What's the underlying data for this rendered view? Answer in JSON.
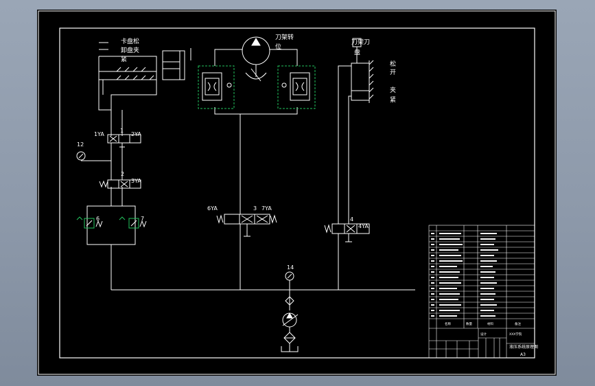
{
  "drawing": {
    "labels": {
      "chuck_clamp": "卡盘松",
      "chuck_clamp_2": "卸盘夹",
      "chuck_clamp_3": "紧",
      "turret_rotate": "刀架转",
      "turret_rotate_2": "位",
      "turret_tool": "刀架刀",
      "turret_tool_2": "盘",
      "loosen": "松",
      "open": "开",
      "clamp": "夹",
      "tight": "紧"
    },
    "components": {
      "valve1_num": "1",
      "valve1_left": "1YA",
      "valve1_right": "2YA",
      "gauge12": "12",
      "valve2_num": "2",
      "valve2_right": "3YA",
      "relief6": "6",
      "relief7": "7",
      "valve3_left": "6YA",
      "valve3_num": "3",
      "valve3_right": "7YA",
      "valve4_num": "4",
      "valve4_right": "4YA",
      "gauge14": "14"
    },
    "title_block": {
      "drawing_title": "液压系统原理图",
      "scale_label": "A3",
      "column_name": "名称",
      "column_qty": "数量",
      "column_material": "材料",
      "column_note": "备注",
      "designer": "设计",
      "company": "XXX学院"
    }
  }
}
